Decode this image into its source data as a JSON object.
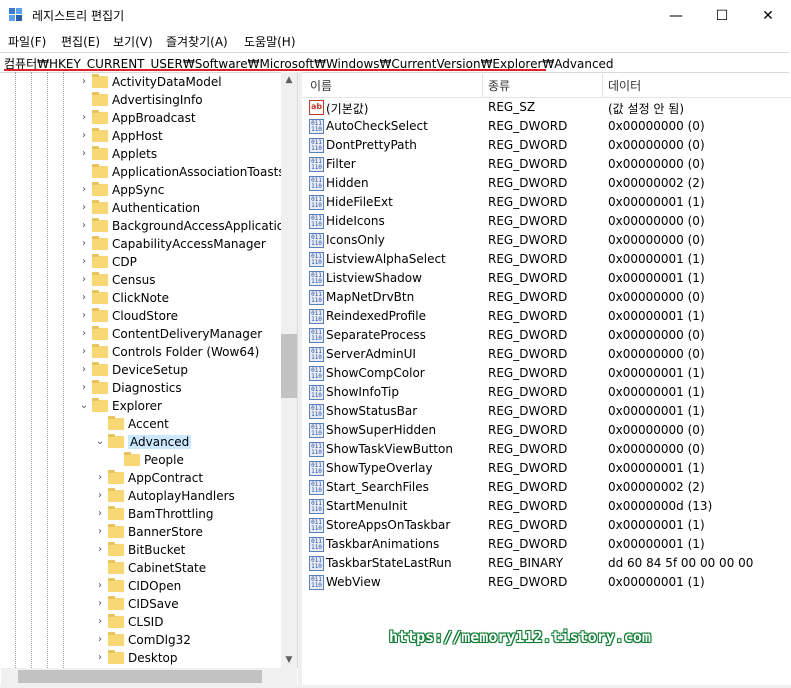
{
  "window": {
    "title": "레지스트리 편집기",
    "minimize": "—",
    "maximize": "☐",
    "close": "✕"
  },
  "menu": [
    "파일(F)",
    "편집(E)",
    "보기(V)",
    "즐겨찾기(A)",
    "도움말(H)"
  ],
  "address": "컴퓨터₩HKEY_CURRENT_USER₩Software₩Microsoft₩Windows₩CurrentVersion₩Explorer₩Advanced",
  "tree": [
    {
      "label": "ActivityDataModel",
      "expandable": true
    },
    {
      "label": "AdvertisingInfo",
      "expandable": false
    },
    {
      "label": "AppBroadcast",
      "expandable": true
    },
    {
      "label": "AppHost",
      "expandable": true
    },
    {
      "label": "Applets",
      "expandable": true
    },
    {
      "label": "ApplicationAssociationToasts",
      "expandable": false
    },
    {
      "label": "AppSync",
      "expandable": true
    },
    {
      "label": "Authentication",
      "expandable": true
    },
    {
      "label": "BackgroundAccessApplications",
      "expandable": true
    },
    {
      "label": "CapabilityAccessManager",
      "expandable": true
    },
    {
      "label": "CDP",
      "expandable": true
    },
    {
      "label": "Census",
      "expandable": true
    },
    {
      "label": "ClickNote",
      "expandable": true
    },
    {
      "label": "CloudStore",
      "expandable": true
    },
    {
      "label": "ContentDeliveryManager",
      "expandable": true
    },
    {
      "label": "Controls Folder (Wow64)",
      "expandable": true
    },
    {
      "label": "DeviceSetup",
      "expandable": true
    },
    {
      "label": "Diagnostics",
      "expandable": true
    },
    {
      "label": "Explorer",
      "expandable": true,
      "expanded": true
    },
    {
      "label": "Accent",
      "expandable": false,
      "level": 1
    },
    {
      "label": "Advanced",
      "expandable": true,
      "expanded": true,
      "level": 1,
      "selected": true
    },
    {
      "label": "People",
      "expandable": false,
      "level": 2
    },
    {
      "label": "AppContract",
      "expandable": true,
      "level": 1
    },
    {
      "label": "AutoplayHandlers",
      "expandable": true,
      "level": 1
    },
    {
      "label": "BamThrottling",
      "expandable": true,
      "level": 1
    },
    {
      "label": "BannerStore",
      "expandable": true,
      "level": 1
    },
    {
      "label": "BitBucket",
      "expandable": true,
      "level": 1
    },
    {
      "label": "CabinetState",
      "expandable": false,
      "level": 1
    },
    {
      "label": "CIDOpen",
      "expandable": true,
      "level": 1
    },
    {
      "label": "CIDSave",
      "expandable": true,
      "level": 1
    },
    {
      "label": "CLSID",
      "expandable": true,
      "level": 1
    },
    {
      "label": "ComDlg32",
      "expandable": true,
      "level": 1
    },
    {
      "label": "Desktop",
      "expandable": true,
      "level": 1
    }
  ],
  "columns": {
    "name": "이름",
    "type": "종류",
    "data": "데이터"
  },
  "values": [
    {
      "name": "(기본값)",
      "type": "REG_SZ",
      "data": "(값 설정 안 됨)",
      "icon": "sz"
    },
    {
      "name": "AutoCheckSelect",
      "type": "REG_DWORD",
      "data": "0x00000000 (0)",
      "icon": "dword"
    },
    {
      "name": "DontPrettyPath",
      "type": "REG_DWORD",
      "data": "0x00000000 (0)",
      "icon": "dword"
    },
    {
      "name": "Filter",
      "type": "REG_DWORD",
      "data": "0x00000000 (0)",
      "icon": "dword"
    },
    {
      "name": "Hidden",
      "type": "REG_DWORD",
      "data": "0x00000002 (2)",
      "icon": "dword"
    },
    {
      "name": "HideFileExt",
      "type": "REG_DWORD",
      "data": "0x00000001 (1)",
      "icon": "dword"
    },
    {
      "name": "HideIcons",
      "type": "REG_DWORD",
      "data": "0x00000000 (0)",
      "icon": "dword"
    },
    {
      "name": "IconsOnly",
      "type": "REG_DWORD",
      "data": "0x00000000 (0)",
      "icon": "dword"
    },
    {
      "name": "ListviewAlphaSelect",
      "type": "REG_DWORD",
      "data": "0x00000001 (1)",
      "icon": "dword"
    },
    {
      "name": "ListviewShadow",
      "type": "REG_DWORD",
      "data": "0x00000001 (1)",
      "icon": "dword"
    },
    {
      "name": "MapNetDrvBtn",
      "type": "REG_DWORD",
      "data": "0x00000000 (0)",
      "icon": "dword"
    },
    {
      "name": "ReindexedProfile",
      "type": "REG_DWORD",
      "data": "0x00000001 (1)",
      "icon": "dword"
    },
    {
      "name": "SeparateProcess",
      "type": "REG_DWORD",
      "data": "0x00000000 (0)",
      "icon": "dword"
    },
    {
      "name": "ServerAdminUI",
      "type": "REG_DWORD",
      "data": "0x00000000 (0)",
      "icon": "dword"
    },
    {
      "name": "ShowCompColor",
      "type": "REG_DWORD",
      "data": "0x00000001 (1)",
      "icon": "dword"
    },
    {
      "name": "ShowInfoTip",
      "type": "REG_DWORD",
      "data": "0x00000001 (1)",
      "icon": "dword"
    },
    {
      "name": "ShowStatusBar",
      "type": "REG_DWORD",
      "data": "0x00000001 (1)",
      "icon": "dword"
    },
    {
      "name": "ShowSuperHidden",
      "type": "REG_DWORD",
      "data": "0x00000000 (0)",
      "icon": "dword"
    },
    {
      "name": "ShowTaskViewButton",
      "type": "REG_DWORD",
      "data": "0x00000000 (0)",
      "icon": "dword"
    },
    {
      "name": "ShowTypeOverlay",
      "type": "REG_DWORD",
      "data": "0x00000001 (1)",
      "icon": "dword"
    },
    {
      "name": "Start_SearchFiles",
      "type": "REG_DWORD",
      "data": "0x00000002 (2)",
      "icon": "dword"
    },
    {
      "name": "StartMenuInit",
      "type": "REG_DWORD",
      "data": "0x0000000d (13)",
      "icon": "dword"
    },
    {
      "name": "StoreAppsOnTaskbar",
      "type": "REG_DWORD",
      "data": "0x00000001 (1)",
      "icon": "dword"
    },
    {
      "name": "TaskbarAnimations",
      "type": "REG_DWORD",
      "data": "0x00000001 (1)",
      "icon": "dword"
    },
    {
      "name": "TaskbarStateLastRun",
      "type": "REG_BINARY",
      "data": "dd 60 84 5f 00 00 00 00",
      "icon": "dword"
    },
    {
      "name": "WebView",
      "type": "REG_DWORD",
      "data": "0x00000001 (1)",
      "icon": "dword"
    }
  ],
  "watermark": "https://memory112.tistory.com",
  "colors": {
    "selection": "#cce8ff",
    "folder": "#f8d775",
    "address_underline": "#e0202a",
    "watermark_outline": "#0a7a2f"
  }
}
